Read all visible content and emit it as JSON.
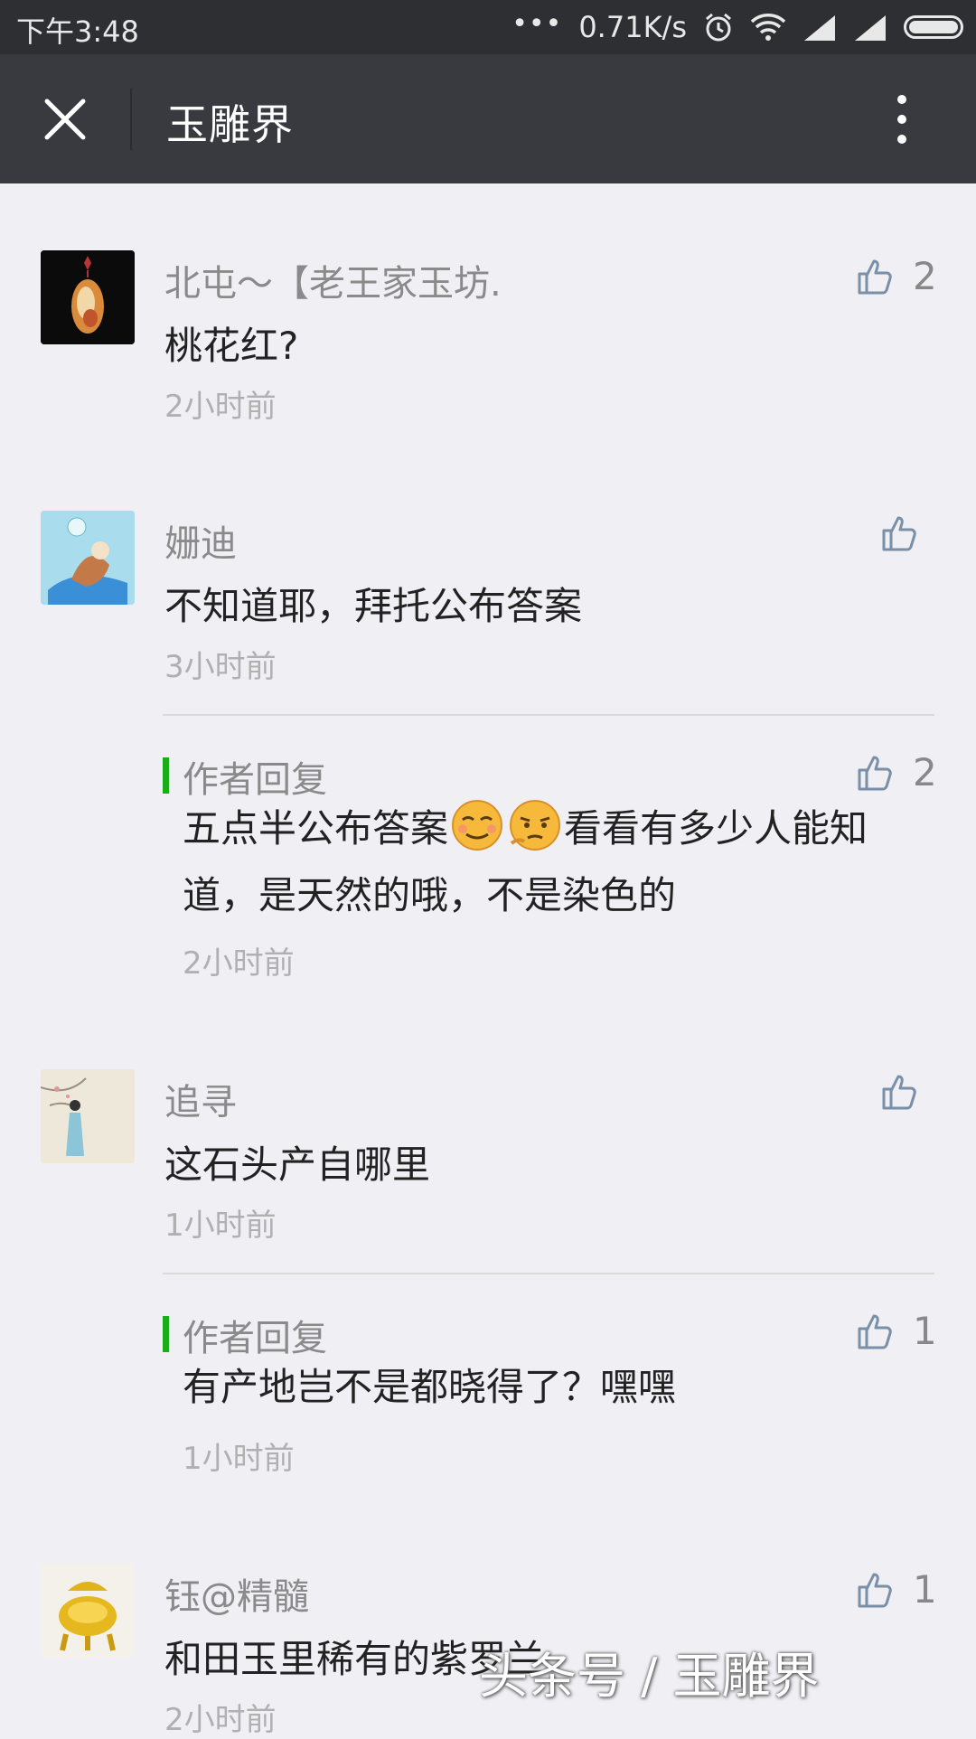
{
  "status_bar": {
    "time": "下午3:48",
    "more": "•••",
    "net_speed": "0.71K/s"
  },
  "header": {
    "title": "玉雕界"
  },
  "comments": [
    {
      "name": "北屯～【老王家玉坊.",
      "text": "桃花红?",
      "time": "2小时前",
      "likes": "2"
    },
    {
      "name": "姗迪",
      "text": "不知道耶，拜托公布答案",
      "time": "3小时前",
      "likes": "",
      "reply": {
        "label": "作者回复",
        "text_a": "五点半公布答案",
        "text_b": "看看有多少人能知道，是天然的哦，不是染色的",
        "time": "2小时前",
        "likes": "2"
      }
    },
    {
      "name": "追寻",
      "text": "这石头产自哪里",
      "time": "1小时前",
      "likes": "",
      "reply": {
        "label": "作者回复",
        "text": "有产地岂不是都晓得了？嘿嘿",
        "time": "1小时前",
        "likes": "1"
      }
    },
    {
      "name": "钰@精髓",
      "text": "和田玉里稀有的紫罗兰",
      "time": "2小时前",
      "likes": "1"
    }
  ],
  "watermark": "头条号 / 玉雕界",
  "colors": {
    "header_bg": "#393a3f",
    "status_bg": "#2e2f33",
    "reply_accent": "#1aad19",
    "page_bg": "#efeff4"
  }
}
